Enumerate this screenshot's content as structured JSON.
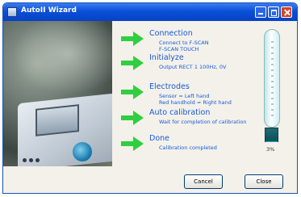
{
  "window": {
    "title": "AutoII Wizard"
  },
  "steps": [
    {
      "title": "Connection",
      "details": [
        "Connect to F-SCAN",
        "F-SCAN TOUCH"
      ]
    },
    {
      "title": "Initialyze",
      "details": [
        "Output RECT 1  100Hz,  0V"
      ]
    },
    {
      "title": "Electrodes",
      "details": [
        "Sensor = Left hand",
        "Red handhold = Right hand"
      ]
    },
    {
      "title": "Auto calibration",
      "details": [
        "Wait for completion of calibration"
      ]
    },
    {
      "title": "Done",
      "details": [
        "Calibration completed"
      ]
    }
  ],
  "progress": {
    "percent_label": "3%",
    "value": 0.03
  },
  "buttons": {
    "cancel": "Cancel",
    "close": "Close"
  },
  "colors": {
    "accent_text": "#1a5ad8",
    "arrow_green": "#2fcf3f",
    "titlebar": "#0a4fd8"
  }
}
